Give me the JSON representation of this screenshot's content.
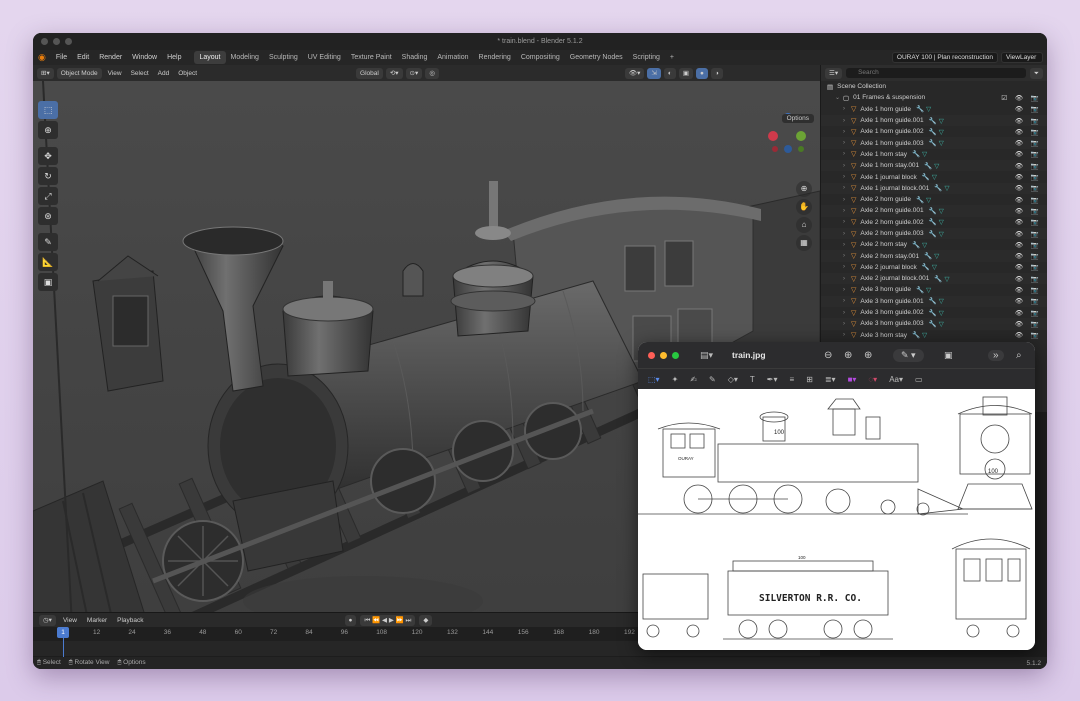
{
  "window": {
    "title": "* train.blend - Blender 5.1.2"
  },
  "menu": [
    "File",
    "Edit",
    "Render",
    "Window",
    "Help"
  ],
  "workspaces": [
    {
      "label": "Layout",
      "active": true
    },
    {
      "label": "Modeling"
    },
    {
      "label": "Sculpting"
    },
    {
      "label": "UV Editing"
    },
    {
      "label": "Texture Paint"
    },
    {
      "label": "Shading"
    },
    {
      "label": "Animation"
    },
    {
      "label": "Rendering"
    },
    {
      "label": "Compositing"
    },
    {
      "label": "Geometry Nodes"
    },
    {
      "label": "Scripting"
    },
    {
      "label": "+"
    }
  ],
  "scene_field": "OURAY 100 | Plan reconstruction",
  "view_layer": "ViewLayer",
  "viewport_header": {
    "mode": "Object Mode",
    "view": "View",
    "select": "Select",
    "add": "Add",
    "object": "Object",
    "orientation": "Global"
  },
  "viewport": {
    "options": "Options",
    "gizmo_axes": [
      "X",
      "Y",
      "Z"
    ]
  },
  "outliner": {
    "search_placeholder": "Search",
    "scene_collection": "Scene Collection",
    "collection": "01 Frames & suspension",
    "items": [
      {
        "name": "Axle 1 horn guide"
      },
      {
        "name": "Axle 1 horn guide.001"
      },
      {
        "name": "Axle 1 horn guide.002"
      },
      {
        "name": "Axle 1 horn guide.003"
      },
      {
        "name": "Axle 1 horn stay"
      },
      {
        "name": "Axle 1 horn stay.001"
      },
      {
        "name": "Axle 1 journal block"
      },
      {
        "name": "Axle 1 journal block.001"
      },
      {
        "name": "Axle 2 horn guide"
      },
      {
        "name": "Axle 2 horn guide.001"
      },
      {
        "name": "Axle 2 horn guide.002"
      },
      {
        "name": "Axle 2 horn guide.003"
      },
      {
        "name": "Axle 2 horn stay"
      },
      {
        "name": "Axle 2 horn stay.001"
      },
      {
        "name": "Axle 2 journal block"
      },
      {
        "name": "Axle 2 journal block.001"
      },
      {
        "name": "Axle 3 horn guide"
      },
      {
        "name": "Axle 3 horn guide.001"
      },
      {
        "name": "Axle 3 horn guide.002"
      },
      {
        "name": "Axle 3 horn guide.003"
      },
      {
        "name": "Axle 3 horn stay"
      }
    ]
  },
  "timeline": {
    "labels": [
      "View",
      "Marker",
      "Playback"
    ],
    "current_frame": "1",
    "ticks": [
      "12",
      "24",
      "36",
      "48",
      "60",
      "72",
      "84",
      "96",
      "108",
      "120",
      "132",
      "144",
      "156",
      "168",
      "180",
      "192"
    ]
  },
  "status": {
    "select": "Select",
    "rotate": "Rotate View",
    "options": "Options",
    "version": "5.1.2"
  },
  "preview": {
    "filename": "train.jpg",
    "lettering": "SILVERTON   R.R.  CO.",
    "engine_number": "100",
    "nameplate": "OURAY"
  }
}
